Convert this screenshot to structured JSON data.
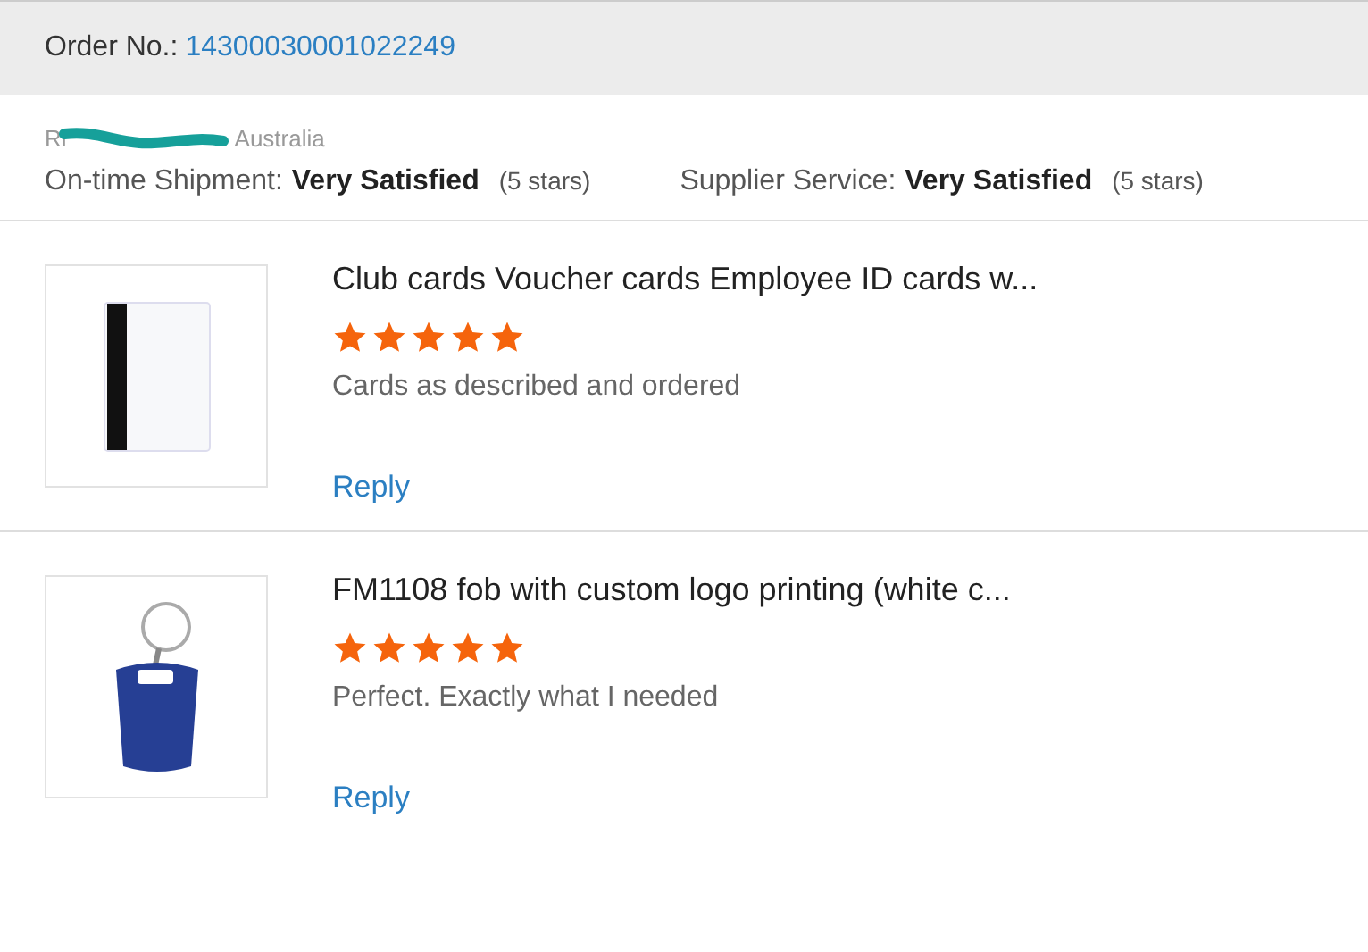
{
  "order": {
    "label": "Order No.:",
    "number": "14300030001022249"
  },
  "reviewer": {
    "name_visible": "Ri",
    "country": "Australia"
  },
  "ratings": [
    {
      "label": "On-time Shipment:",
      "value": "Very Satisfied",
      "stars_text": "(5 stars)"
    },
    {
      "label": "Supplier Service:",
      "value": "Very Satisfied",
      "stars_text": "(5 stars)"
    }
  ],
  "reviews": [
    {
      "kind": "card",
      "title": "Club cards Voucher cards Employee ID cards w...",
      "stars": 5,
      "comment": "Cards as described and ordered",
      "reply": "Reply"
    },
    {
      "kind": "fob",
      "title": "FM1108 fob with custom logo printing (white c...",
      "stars": 5,
      "comment": "Perfect. Exactly what I needed",
      "reply": "Reply"
    }
  ]
}
